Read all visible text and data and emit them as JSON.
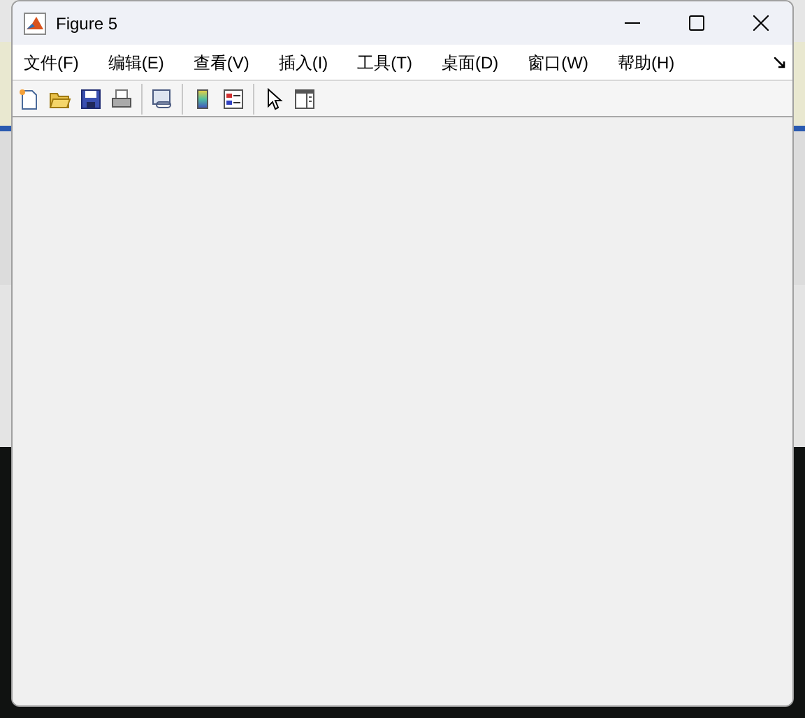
{
  "window": {
    "title": "Figure 5"
  },
  "menu": [
    {
      "label": "文件(F)"
    },
    {
      "label": "编辑(E)"
    },
    {
      "label": "查看(V)"
    },
    {
      "label": "插入(I)"
    },
    {
      "label": "工具(T)"
    },
    {
      "label": "桌面(D)"
    },
    {
      "label": "窗口(W)"
    },
    {
      "label": "帮助(H)"
    }
  ]
}
